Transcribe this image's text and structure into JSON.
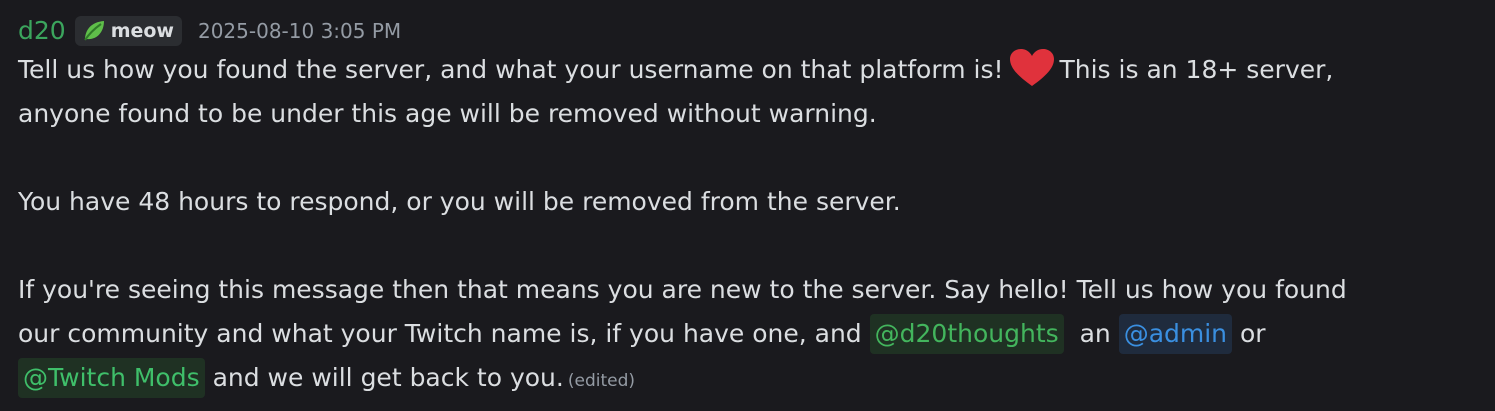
{
  "header": {
    "username": "d20",
    "role_tag": "meow",
    "role_icon": "leaf-icon",
    "timestamp": "2025-08-10 3:05 PM"
  },
  "body": {
    "line1_a": "Tell us how you found the server, and what your username on that platform is!",
    "heart_icon": "red-heart-emoji",
    "line1_b": "This is an 18+ server,",
    "line2": "anyone found to be under this age will be removed without warning.",
    "line3": "You have 48 hours to respond, or you will be removed from the server.",
    "line4": "If you're seeing this message then that means you are new to the server. Say hello! Tell us how you found",
    "line5_a": "our community and what your Twitch name is, if you have one, and",
    "mention_user": "@d20thoughts",
    "line5_b": "an",
    "mention_admin": "@admin",
    "line5_c": "or",
    "mention_mods": "@Twitch Mods",
    "line6": "and we will get back to you.",
    "edited": "(edited)"
  },
  "colors": {
    "background": "#1a1a1e",
    "username": "#3ba55d",
    "text": "#dbdee1",
    "muted": "#949ba4",
    "mention_user": "#43b55d",
    "mention_admin": "#3a8fe0",
    "mention_mods": "#3fbf6a",
    "heart": "#e0323c"
  }
}
